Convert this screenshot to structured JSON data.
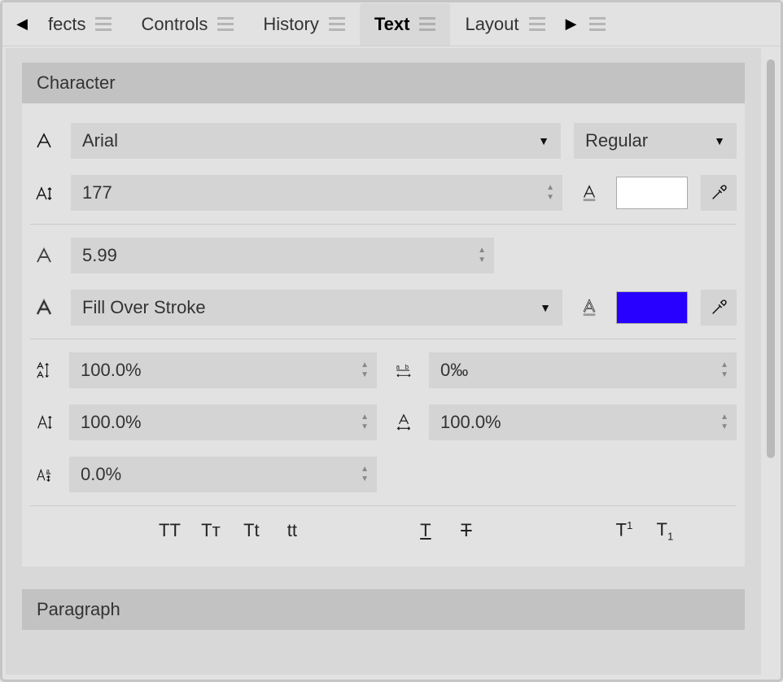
{
  "tabstrip": {
    "arrow_left": "◀",
    "arrow_right": "▶",
    "tabs": [
      {
        "label": "fects",
        "active": false
      },
      {
        "label": "Controls",
        "active": false
      },
      {
        "label": "History",
        "active": false
      },
      {
        "label": "Text",
        "active": true
      },
      {
        "label": "Layout",
        "active": false
      }
    ]
  },
  "sections": {
    "character": {
      "title": "Character"
    },
    "paragraph": {
      "title": "Paragraph"
    }
  },
  "fields": {
    "font_family": "Arial",
    "font_style": "Regular",
    "font_size": "177",
    "stroke_width": "5.99",
    "stroke_order": "Fill Over Stroke",
    "fill_color": "#ffffff",
    "stroke_color": "#2700ff",
    "leading": "100.0%",
    "tracking": "0‰",
    "vertical_scale": "100.0%",
    "horizontal_scale": "100.0%",
    "baseline_shift": "0.0%"
  },
  "case_toggles": {
    "upper": "TT",
    "smallcaps": "Tᴛ",
    "title": "Tt",
    "lower": "tt"
  },
  "line_toggles": {
    "underline": "T",
    "strike": "T"
  },
  "pos_toggles": {
    "superscript_html": "T<sup>1</sup>",
    "subscript_html": "T<sub>1</sub>"
  }
}
